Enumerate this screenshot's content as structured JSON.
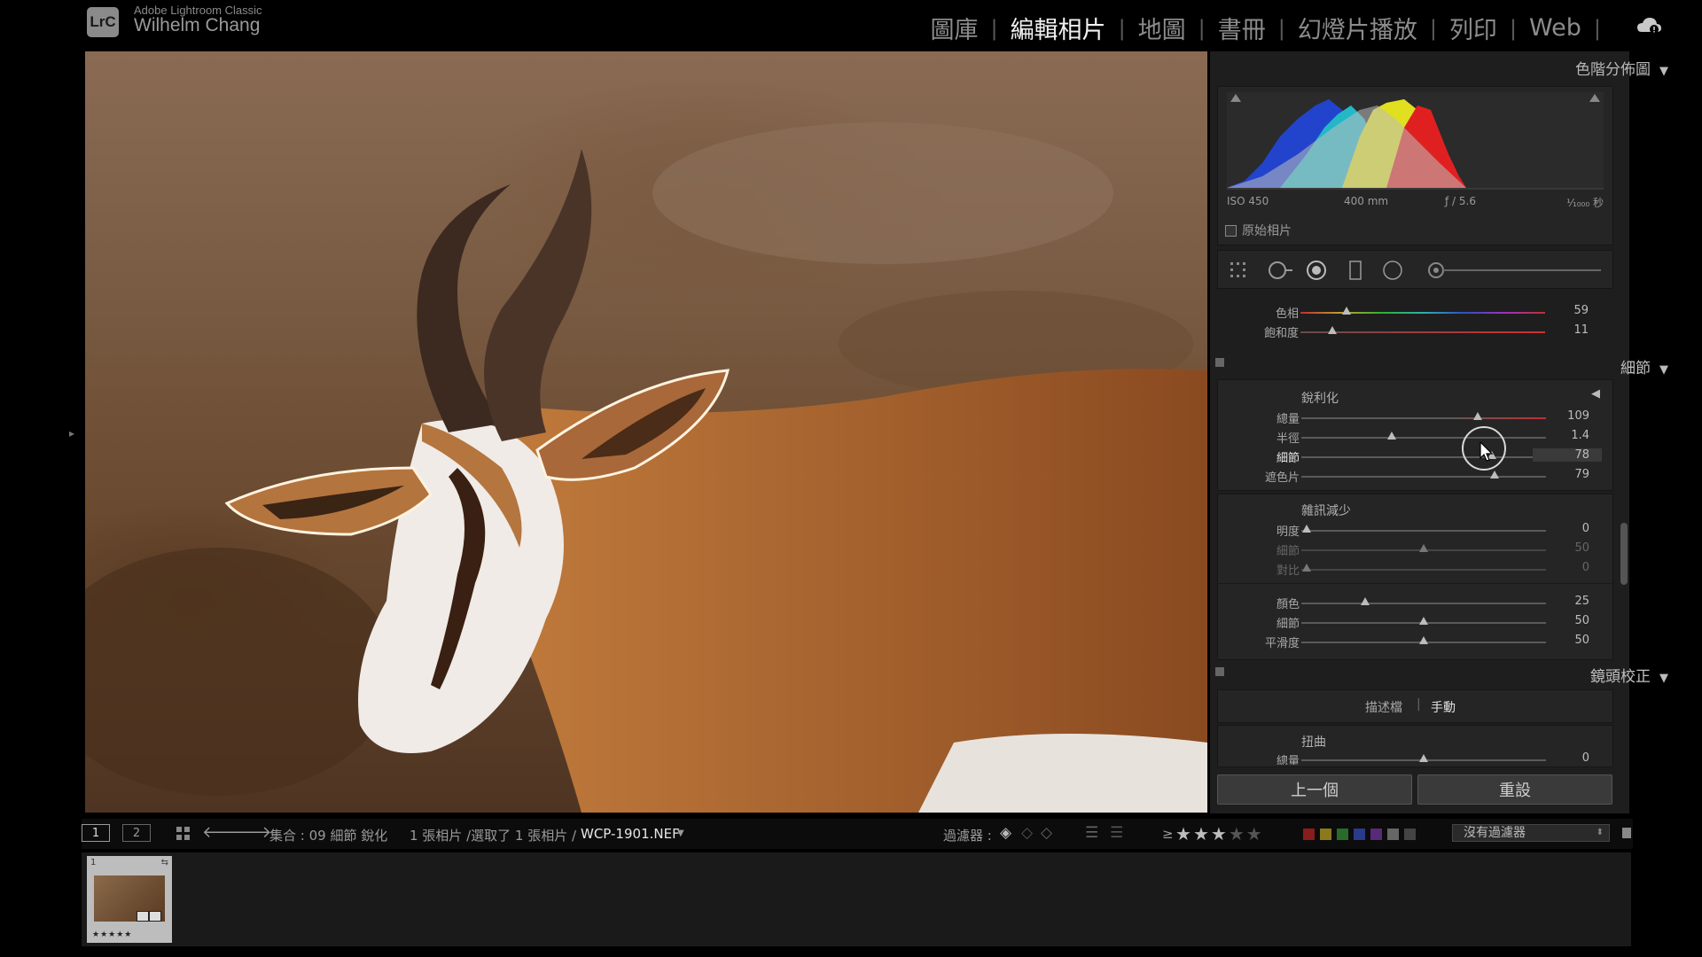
{
  "app": {
    "logo": "LrC",
    "product_name": "Adobe Lightroom Classic",
    "user_name": "Wilhelm Chang"
  },
  "modules": [
    {
      "label": "圖庫",
      "active": false
    },
    {
      "label": "編輯相片",
      "active": true
    },
    {
      "label": "地圖",
      "active": false
    },
    {
      "label": "書冊",
      "active": false
    },
    {
      "label": "幻燈片播放",
      "active": false
    },
    {
      "label": "列印",
      "active": false
    },
    {
      "label": "Web",
      "active": false
    }
  ],
  "histogram": {
    "title": "色階分佈圖",
    "iso": "ISO 450",
    "focal": "400 mm",
    "aperture": "ƒ / 5.6",
    "shutter": "¹⁄₁₀₀₀ 秒",
    "original_photo_label": "原始相片"
  },
  "hsl_partial": {
    "rows": [
      {
        "label": "色相",
        "value": "59",
        "pos": 0.19
      },
      {
        "label": "飽和度",
        "value": "11",
        "pos": 0.13
      }
    ]
  },
  "detail": {
    "title": "細節",
    "sharpening": {
      "title": "銳利化",
      "rows": [
        {
          "label": "總量",
          "value": "109",
          "pos": 0.72
        },
        {
          "label": "半徑",
          "value": "1.4",
          "pos": 0.37
        },
        {
          "label": "細節",
          "value": "78",
          "pos": 0.78
        },
        {
          "label": "遮色片",
          "value": "79",
          "pos": 0.79
        }
      ]
    },
    "noise_reduction": {
      "title": "雜訊減少",
      "luminance_rows": [
        {
          "label": "明度",
          "value": "0",
          "pos": 0.02
        },
        {
          "label": "細節",
          "value": "50",
          "pos": 0.5
        },
        {
          "label": "對比",
          "value": "0",
          "pos": 0.02
        }
      ],
      "color_rows": [
        {
          "label": "顏色",
          "value": "25",
          "pos": 0.26
        },
        {
          "label": "細節",
          "value": "50",
          "pos": 0.5
        },
        {
          "label": "平滑度",
          "value": "50",
          "pos": 0.5
        }
      ]
    }
  },
  "lens": {
    "title": "鏡頭校正",
    "tab_profile": "描述檔",
    "tab_manual": "手動",
    "distortion_title": "扭曲",
    "amount_label": "總量",
    "amount_value": "0"
  },
  "buttons": {
    "previous": "上一個",
    "reset": "重設"
  },
  "filmstrip_bar": {
    "screen1": "1",
    "screen2": "2",
    "collection": "集合 : 09 細節 銳化",
    "selection": "1 張相片 /選取了 1 張相片 /",
    "filename": "WCP-1901.NEF",
    "filter_label": "過濾器 :",
    "rating_prefix": "≥",
    "rating_stars": 3,
    "no_filter": "沒有過濾器",
    "color_labels": [
      "#8a1c1c",
      "#8a7a1c",
      "#2a6a2a",
      "#2a3a8a",
      "#5a2a7a",
      "#666666",
      "#444444"
    ]
  },
  "filmstrip": {
    "thumb_index": "1",
    "thumb_stars": "★★★★★"
  }
}
